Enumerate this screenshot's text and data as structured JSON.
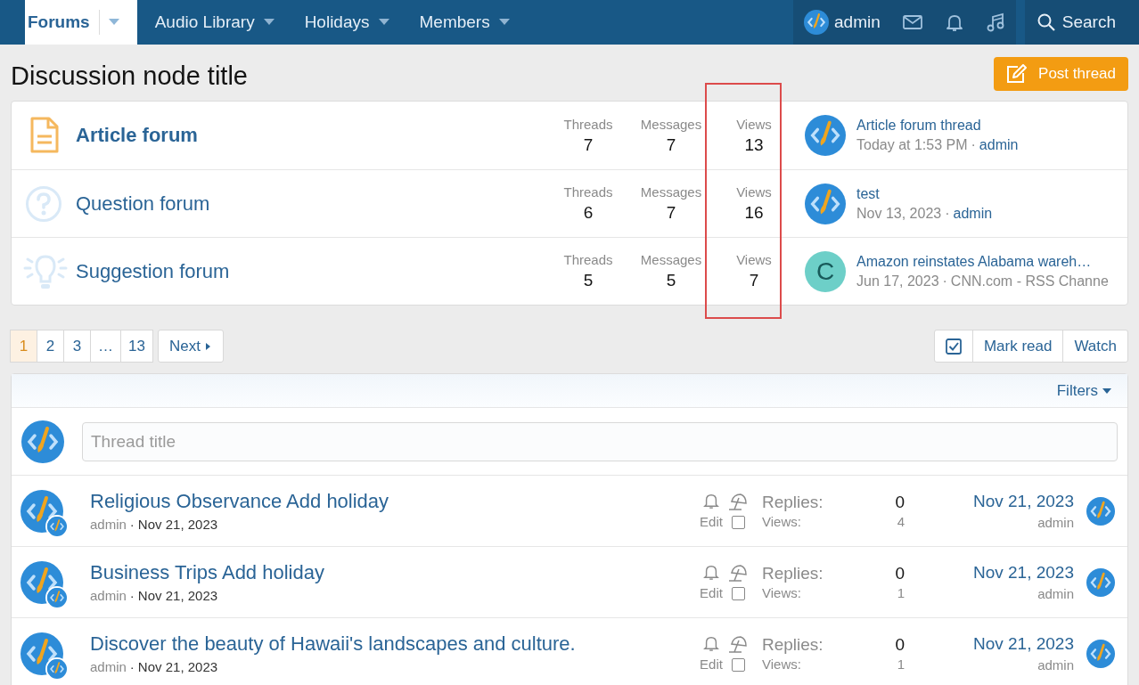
{
  "nav": {
    "tabs": [
      {
        "label": "Forums",
        "selected": true
      },
      {
        "label": "Audio Library",
        "selected": false
      },
      {
        "label": "Holidays",
        "selected": false
      },
      {
        "label": "Members",
        "selected": false
      }
    ],
    "user": "admin",
    "search": "Search"
  },
  "page_title": "Discussion node title",
  "post_button": "Post thread",
  "nodes": [
    {
      "kind": "article",
      "title": "Article forum",
      "unread": true,
      "threads_label": "Threads",
      "threads": "7",
      "messages_label": "Messages",
      "messages": "7",
      "views_label": "Views",
      "views": "13",
      "last": {
        "kind": "logo",
        "title": "Article forum thread",
        "date": "Today at 1:53 PM",
        "sep": "·",
        "by": "admin"
      }
    },
    {
      "kind": "question",
      "title": "Question forum",
      "unread": false,
      "threads_label": "Threads",
      "threads": "6",
      "messages_label": "Messages",
      "messages": "7",
      "views_label": "Views",
      "views": "16",
      "last": {
        "kind": "logo",
        "title": "test",
        "date": "Nov 13, 2023",
        "sep": "·",
        "by": "admin"
      }
    },
    {
      "kind": "suggestion",
      "title": "Suggestion forum",
      "unread": false,
      "threads_label": "Threads",
      "threads": "5",
      "messages_label": "Messages",
      "messages": "5",
      "views_label": "Views",
      "views": "7",
      "last": {
        "kind": "letter",
        "letter": "C",
        "color": "#6dcfc8",
        "title": "Amazon reinstates Alabama wareh…",
        "date": "Jun 17, 2023",
        "sep": "·",
        "by": "CNN.com - RSS Channe"
      }
    }
  ],
  "highlight": true,
  "pages": [
    {
      "label": "1",
      "selected": true
    },
    {
      "label": "2",
      "selected": false
    },
    {
      "label": "3",
      "selected": false
    },
    {
      "label": "…",
      "selected": false
    },
    {
      "label": "13",
      "selected": false
    }
  ],
  "next": "Next",
  "actions": [
    "Mark read",
    "Watch"
  ],
  "filters": "Filters",
  "quick_thread": {
    "placeholder": "Thread title"
  },
  "threads": [
    {
      "title": "Religious Observance Add holiday",
      "author": "admin",
      "sep": "·",
      "date": "Nov 21, 2023",
      "edit": "Edit",
      "checked": false,
      "replies_label": "Replies:",
      "replies": "0",
      "views_label": "Views:",
      "views": "4",
      "last_date": "Nov 21, 2023",
      "last_user": "admin"
    },
    {
      "title": "Business Trips Add holiday",
      "author": "admin",
      "sep": "·",
      "date": "Nov 21, 2023",
      "edit": "Edit",
      "checked": false,
      "replies_label": "Replies:",
      "replies": "0",
      "views_label": "Views:",
      "views": "1",
      "last_date": "Nov 21, 2023",
      "last_user": "admin"
    },
    {
      "title": "Discover the beauty of Hawaii's landscapes and culture.",
      "author": "admin",
      "sep": "·",
      "date": "Nov 21, 2023",
      "edit": "Edit",
      "checked": false,
      "replies_label": "Replies:",
      "replies": "0",
      "views_label": "Views:",
      "views": "1",
      "last_date": "Nov 21, 2023",
      "last_user": "admin"
    }
  ]
}
